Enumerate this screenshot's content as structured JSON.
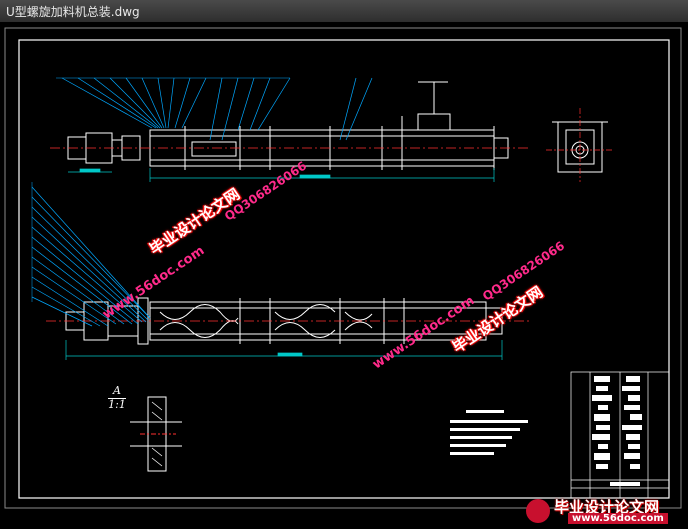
{
  "window": {
    "title": "U型螺旋加料机总装.dwg"
  },
  "drawing": {
    "section_label": "A",
    "section_scale": "1:1",
    "colors": {
      "background": "#000000",
      "frame": "#ffffff",
      "leader": "#00a8ff",
      "center": "#ff3030",
      "dim": "#00c8c8",
      "titleblock": "#ffffff"
    }
  },
  "watermarks": {
    "url": "www.56doc.com",
    "qq": "QQ306826066",
    "site_name": "毕业设计论文网"
  },
  "logo": {
    "name": "毕业设计论文网",
    "url": "www.56doc.com"
  }
}
